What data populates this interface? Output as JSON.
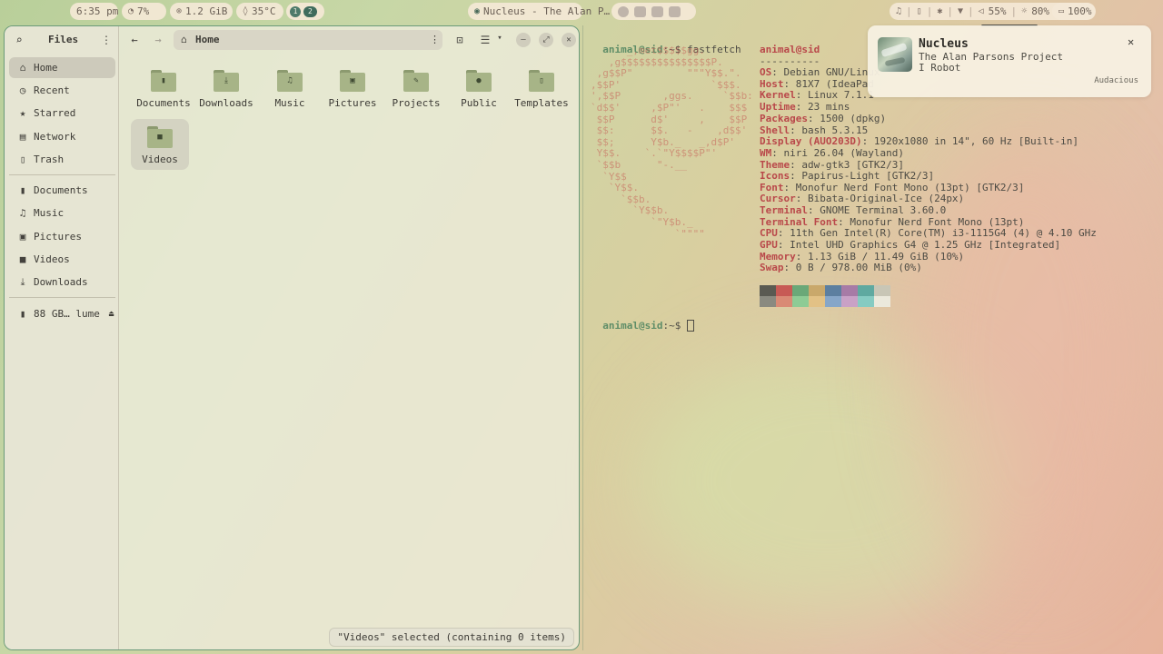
{
  "topbar": {
    "clock": "6:35 pm",
    "cpu": "7%",
    "ram": "1.2 GiB",
    "temp": "35°C",
    "workspaces": [
      "1",
      "2"
    ],
    "now_playing": "Nucleus - The Alan P…",
    "volume": "55%",
    "brightness": "80%",
    "battery": "100%"
  },
  "files": {
    "app_title": "Files",
    "location": "Home",
    "sidebar": {
      "places": [
        {
          "label": "Home",
          "icon": "home-icon",
          "active": true
        },
        {
          "label": "Recent",
          "icon": "clock-icon",
          "active": false
        },
        {
          "label": "Starred",
          "icon": "star-icon",
          "active": false
        },
        {
          "label": "Network",
          "icon": "network-icon",
          "active": false
        },
        {
          "label": "Trash",
          "icon": "trash-icon",
          "active": false
        }
      ],
      "bookmarks": [
        {
          "label": "Documents",
          "icon": "document-icon"
        },
        {
          "label": "Music",
          "icon": "music-icon"
        },
        {
          "label": "Pictures",
          "icon": "picture-icon"
        },
        {
          "label": "Videos",
          "icon": "video-icon"
        },
        {
          "label": "Downloads",
          "icon": "download-icon"
        }
      ],
      "drive": "88 GB… lume"
    },
    "folders": [
      {
        "label": "Documents",
        "icon": "document-icon"
      },
      {
        "label": "Downloads",
        "icon": "download-icon"
      },
      {
        "label": "Music",
        "icon": "music-icon"
      },
      {
        "label": "Pictures",
        "icon": "picture-icon"
      },
      {
        "label": "Projects",
        "icon": "tools-icon"
      },
      {
        "label": "Public",
        "icon": "person-icon"
      },
      {
        "label": "Templates",
        "icon": "template-icon"
      },
      {
        "label": "Videos",
        "icon": "video-icon",
        "selected": true
      }
    ],
    "status": "\"Videos\" selected (containing 0 items)"
  },
  "terminal": {
    "prompt": "animal@sid",
    "prompt_suffix": ":~$",
    "command": " fastfetch",
    "user_host": "animal@sid",
    "divider": "----------",
    "info": [
      {
        "label": "OS",
        "value": ": Debian GNU/Linux"
      },
      {
        "label": "Host",
        "value": ": 81X7 (IdeaPad"
      },
      {
        "label": "Kernel",
        "value": ": Linux 7.1.1"
      },
      {
        "label": "Uptime",
        "value": ": 23 mins"
      },
      {
        "label": "Packages",
        "value": ": 1500 (dpkg)"
      },
      {
        "label": "Shell",
        "value": ": bash 5.3.15"
      },
      {
        "label": "Display (AUO203D)",
        "value": ": 1920x1080 in 14\", 60 Hz [Built-in]"
      },
      {
        "label": "WM",
        "value": ": niri 26.04 (Wayland)"
      },
      {
        "label": "Theme",
        "value": ": adw-gtk3 [GTK2/3]"
      },
      {
        "label": "Icons",
        "value": ": Papirus-Light [GTK2/3]"
      },
      {
        "label": "Font",
        "value": ": Monofur Nerd Font Mono (13pt) [GTK2/3]"
      },
      {
        "label": "Cursor",
        "value": ": Bibata-Original-Ice (24px)"
      },
      {
        "label": "Terminal",
        "value": ": GNOME Terminal 3.60.0"
      },
      {
        "label": "Terminal Font",
        "value": ": Monofur Nerd Font Mono (13pt)"
      },
      {
        "label": "CPU",
        "value": ": 11th Gen Intel(R) Core(TM) i3-1115G4 (4) @ 4.10 GHz"
      },
      {
        "label": "GPU",
        "value": ": Intel UHD Graphics G4 @ 1.25 GHz [Integrated]"
      },
      {
        "label": "Memory",
        "value": ": 1.13 GiB / 11.49 GiB (10%)"
      },
      {
        "label": "Swap",
        "value": ": 0 B / 978.00 MiB (0%)"
      }
    ],
    "palette": [
      "#5a5a52",
      "#c75a55",
      "#6aa878",
      "#c9a86b",
      "#5c7fa0",
      "#a77ba6",
      "#5fa9a0",
      "#c8c6b6",
      "#8a8a80",
      "#d98a75",
      "#8ecb95",
      "#e2c185",
      "#86a6c8",
      "#c9a1c6",
      "#86cbc2",
      "#ebe9dc"
    ]
  },
  "notification": {
    "title": "Nucleus",
    "artist": "The Alan Parsons Project",
    "album": "I Robot",
    "app": "Audacious"
  }
}
